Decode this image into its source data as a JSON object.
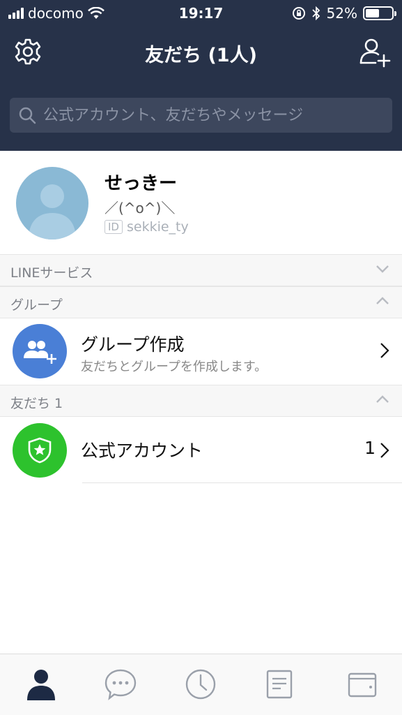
{
  "status_bar": {
    "carrier": "docomo",
    "time": "19:17",
    "battery": "52%"
  },
  "header": {
    "title": "友だち (1人)"
  },
  "search": {
    "placeholder": "公式アカウント、友だちやメッセージ"
  },
  "profile": {
    "name": "せっきー",
    "status_message": "／(^o^)＼",
    "id_badge": "ID",
    "user_id": "sekkie_ty"
  },
  "sections": {
    "line_services": "LINEサービス",
    "groups": "グループ",
    "friends": "友だち 1"
  },
  "group_create": {
    "title": "グループ作成",
    "subtitle": "友だちとグループを作成します。"
  },
  "official_accounts": {
    "title": "公式アカウント",
    "count": "1"
  },
  "colors": {
    "header_bg": "#273249",
    "search_bg": "#3d475d",
    "group_icon": "#4a7fd6",
    "official_icon": "#2dc22d",
    "tab_active": "#1d2a44",
    "tab_inactive": "#9aa0aa"
  },
  "tabs": [
    "friends-icon",
    "chat-icon",
    "timeline-icon",
    "news-icon",
    "wallet-icon"
  ]
}
